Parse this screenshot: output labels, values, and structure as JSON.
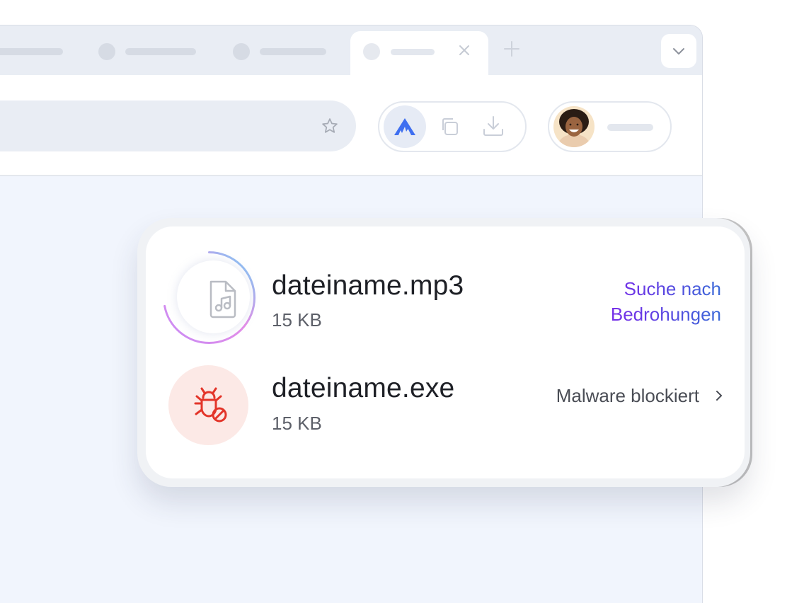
{
  "downloads": [
    {
      "file_name": "dateiname.mp3",
      "file_size": "15 KB",
      "status": "Suche nach Bedrohungen",
      "state": "scanning",
      "icon": "music-file-icon",
      "scan_progress": 0.72
    },
    {
      "file_name": "dateiname.exe",
      "file_size": "15 KB",
      "status": "Malware blockiert",
      "state": "blocked",
      "icon": "blocked-bug-icon"
    }
  ],
  "icons": {
    "tab_close": "close-icon",
    "new_tab": "plus-icon",
    "tab_menu": "chevron-down-icon",
    "bookmark": "star-icon",
    "extension": "nordvpn-icon",
    "copy": "copy-icon",
    "download": "download-icon",
    "profile": "avatar"
  },
  "colors": {
    "accent_blue": "#3f6ff0",
    "danger_red": "#e3352a",
    "danger_bg": "#fce9e6",
    "scan_gradient_start": "#9a1ef0",
    "scan_gradient_end": "#3a6ad8"
  }
}
